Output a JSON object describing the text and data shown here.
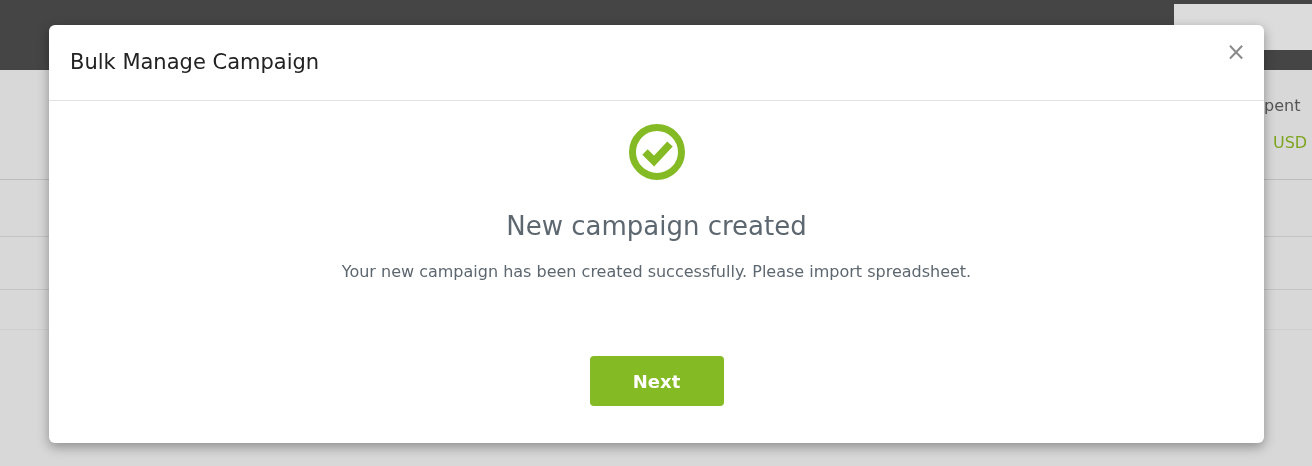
{
  "background": {
    "spent_label": "pent",
    "currency": "USD"
  },
  "modal": {
    "title": "Bulk Manage Campaign",
    "close": "×",
    "heading": "New campaign created",
    "message": "Your new campaign has been created successfully. Please import spreadsheet.",
    "button": "Next"
  }
}
